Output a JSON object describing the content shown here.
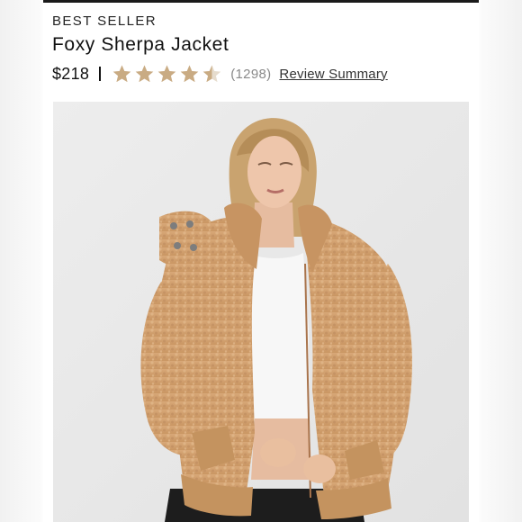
{
  "product": {
    "badge": "BEST SELLER",
    "title": "Foxy Sherpa Jacket",
    "price": "$218",
    "rating": 4.5,
    "rating_max": 5,
    "review_count": "(1298)",
    "review_link": "Review Summary",
    "star_color": "#c9ab83",
    "star_icon": "star-icon",
    "image_icon": "product-photo"
  }
}
